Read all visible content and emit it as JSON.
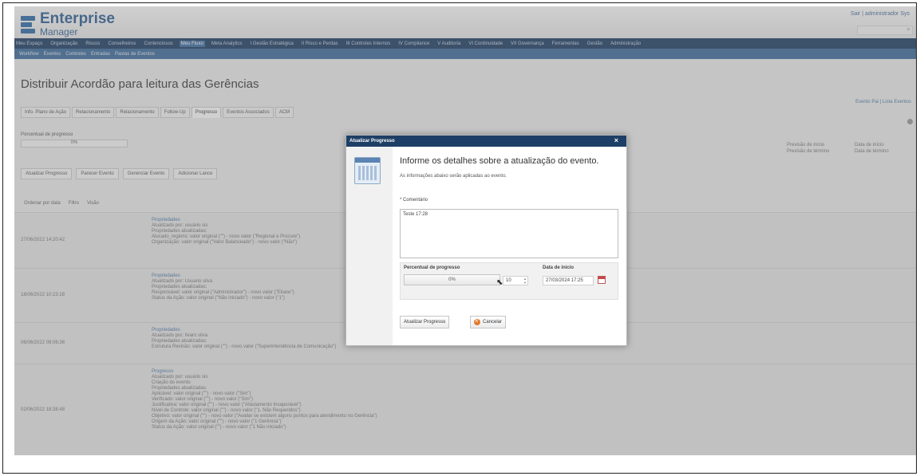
{
  "header": {
    "brand_line1": "Enterprise",
    "brand_line2": "Manager",
    "user_info": "Sair | administrador Sys",
    "search_icon": "search-icon"
  },
  "nav_main": [
    "Meu Espaço",
    "Organização",
    "Riscos",
    "Conselheiros",
    "Contenciosos",
    "Meu Fluxo",
    "Meta Analytics",
    "I Gestão Estratégica",
    "II Risco e Perdas",
    "III Controles Internos",
    "IV Compliance",
    "V Auditoria",
    "VI Continuidade",
    "VII Governança",
    "Ferramentas",
    "Gestão",
    "Administração"
  ],
  "nav_main_active": "Meu Fluxo",
  "nav_sub": [
    "Workflow",
    "Eventos",
    "Controles",
    "Entradas",
    "Pastas de Eventos"
  ],
  "page": {
    "title": "Distribuir Acordão para leitura das Gerências",
    "title_links": "Evento Pai | Lista Eventos"
  },
  "tabs": [
    "Info. Plano de Ação",
    "Relacionamento",
    "Relacionamento",
    "Follow-Up",
    "Progresso",
    "Eventos Associados",
    "ACM"
  ],
  "tabs_active": "Progresso",
  "progress_panel": {
    "label": "Porcentual de progresso",
    "value": "0%"
  },
  "right_meta": {
    "col1": [
      "Previsão de início",
      "Previsão de término"
    ],
    "col2": [
      "Data de início",
      "Data de término"
    ]
  },
  "toolbar": [
    "Atualizar Progresso",
    "Parecer Evento",
    "Gerenciar Evento",
    "Adicionar Lance"
  ],
  "filterbar": [
    "Ordenar por data",
    "Filtro",
    "Visão"
  ],
  "timeline": [
    {
      "date": "27/06/2022 14:20:42",
      "title": "Propriedades",
      "lines": [
        "Atualizado por: usuário sis",
        "Propriedades atualizadas:",
        "Alocado_regions: valor original (\"\") - novo valor (\"Regional e Procure\")",
        "Organização: valor original (\"Valor Balanceado\") - novo valor (\"Não\")"
      ]
    },
    {
      "date": "18/06/2022 10:23:28",
      "title": "Propriedades",
      "lines": [
        "Atualizado por: Usuario silva",
        "Propriedades atualizadas:",
        "Responsável: valor original (\"Administrador\") - novo valor (\"Eliane\")",
        "Status da Ação: valor original (\"Não iniciado\") - novo valor (\"1\")"
      ]
    },
    {
      "date": "06/06/2022 09:06:36",
      "title": "Propriedades",
      "lines": [
        "Atualizado por: Ilvaro silva",
        "Propriedades atualizadas:",
        "Estrutura Revisão: valor original (\"\") - novo valor (\"Superintendência de Comunicação\")"
      ]
    },
    {
      "date": "02/06/2022 18:38:48",
      "title": "Progresso",
      "lines": [
        "Atualizado por: usuário sis",
        "Criação do evento",
        "Propriedades atualizadas:",
        "Aplicável: valor original (\"\") - novo valor (\"Sim\")",
        "Verificado: valor original (\"\") - novo valor (\"Sim\")",
        "Justificativa: valor original (\"\") - novo valor (\"Afastamento Insaporável\")",
        "Nível de Controle: valor original (\"\") - novo valor (\"1. Não Requeridos\")",
        "Objetivo: valor original (\"\") - novo valor (\"Avaliar se existem alguns pontos para atendimento no Gerência\")",
        "Origem da Ação: valor original (\"\") - novo valor (\"1 Gerência\")",
        "Status da Ação: valor original (\"\") - novo valor (\"1 Não iniciado\")"
      ]
    }
  ],
  "modal": {
    "title": "Atualizar Progresso",
    "heading": "Informe os detalhes sobre a atualização do evento.",
    "subheading": "As informações abaixo serão aplicadas ao evento.",
    "comment_label": "* Comentário",
    "comment_value": "Teste 17:28",
    "progress_label": "Percentual de progresso",
    "progress_value": "0%",
    "progress_fraction": 0.0,
    "stepper_value": "10",
    "date_label": "Data de início",
    "date_value": "27/03/2024 17:25",
    "save_label": "Atualizar Progresso",
    "cancel_label": "Cancelar"
  }
}
